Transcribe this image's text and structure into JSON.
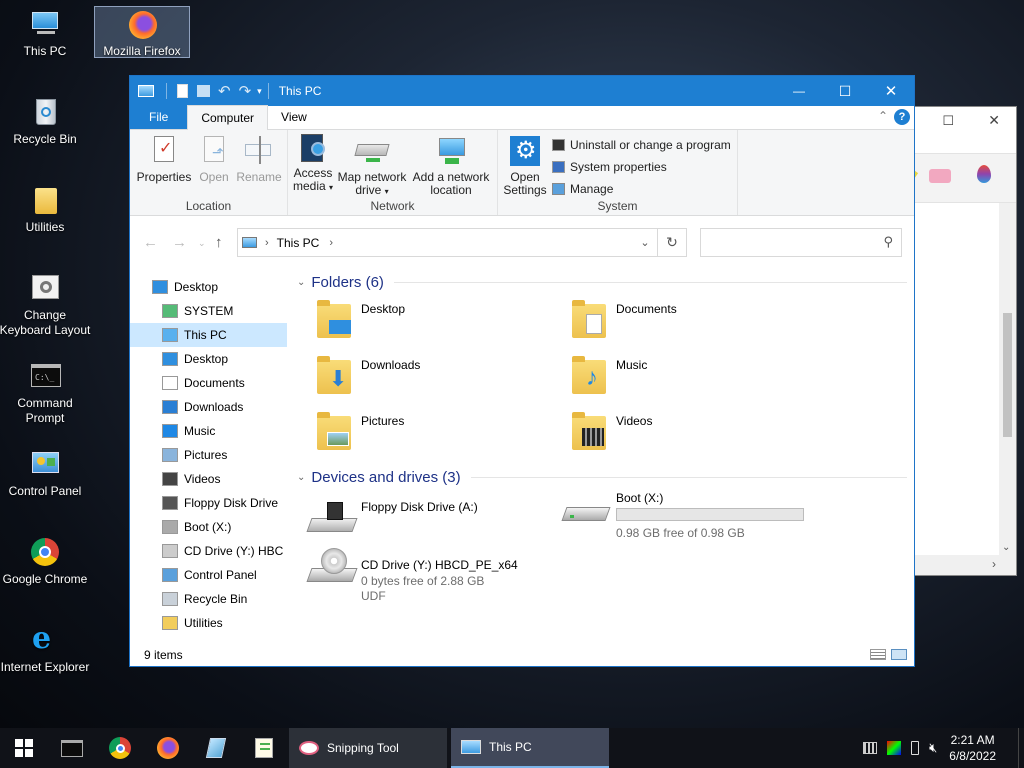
{
  "desktop": {
    "icons": [
      {
        "label": "This PC",
        "icon": "this-pc-icon"
      },
      {
        "label": "Mozilla Firefox",
        "icon": "firefox-icon"
      },
      {
        "label": "Recycle Bin",
        "icon": "recycle-bin-icon"
      },
      {
        "label": "Utilities",
        "icon": "folder-icon"
      },
      {
        "label": "Change Keyboard Layout",
        "icon": "keyboard-settings-icon"
      },
      {
        "label": "Command Prompt",
        "icon": "command-prompt-icon"
      },
      {
        "label": "Control Panel",
        "icon": "control-panel-icon"
      },
      {
        "label": "Google Chrome",
        "icon": "chrome-icon"
      },
      {
        "label": "Internet Explorer",
        "icon": "internet-explorer-icon"
      }
    ]
  },
  "window": {
    "title": "This PC",
    "title_buttons": {
      "minimize": "—",
      "maximize": "☐",
      "close": "✕"
    },
    "tabs": {
      "file": "File",
      "computer": "Computer",
      "view": "View"
    },
    "ribbon": {
      "location": {
        "label": "Location",
        "properties": "Properties",
        "open": "Open",
        "rename": "Rename"
      },
      "network": {
        "label": "Network",
        "access_media": "Access media",
        "map_network_drive": "Map network drive",
        "add_network_location": "Add a network location"
      },
      "system": {
        "label": "System",
        "open_settings": "Open Settings",
        "uninstall": "Uninstall or change a program",
        "system_properties": "System properties",
        "manage": "Manage"
      }
    },
    "address": {
      "path": "This PC",
      "search_placeholder": ""
    },
    "nav": [
      {
        "label": "Desktop",
        "level": 0,
        "icon": "desktop-icon"
      },
      {
        "label": "SYSTEM",
        "level": 1,
        "icon": "user-icon"
      },
      {
        "label": "This PC",
        "level": 1,
        "icon": "this-pc-icon",
        "selected": true
      },
      {
        "label": "Desktop",
        "level": 2,
        "icon": "desktop-icon"
      },
      {
        "label": "Documents",
        "level": 2,
        "icon": "documents-icon"
      },
      {
        "label": "Downloads",
        "level": 2,
        "icon": "downloads-icon"
      },
      {
        "label": "Music",
        "level": 2,
        "icon": "music-icon"
      },
      {
        "label": "Pictures",
        "level": 2,
        "icon": "pictures-icon"
      },
      {
        "label": "Videos",
        "level": 2,
        "icon": "videos-icon"
      },
      {
        "label": "Floppy Disk Drive",
        "level": 2,
        "icon": "floppy-icon"
      },
      {
        "label": "Boot (X:)",
        "level": 2,
        "icon": "drive-icon"
      },
      {
        "label": "CD Drive (Y:) HBC",
        "level": 2,
        "icon": "cd-drive-icon"
      },
      {
        "label": "Control Panel",
        "level": 1,
        "icon": "control-panel-icon"
      },
      {
        "label": "Recycle Bin",
        "level": 1,
        "icon": "recycle-bin-icon"
      },
      {
        "label": "Utilities",
        "level": 1,
        "icon": "folder-icon"
      }
    ],
    "folders_header": "Folders (6)",
    "folders": [
      {
        "name": "Desktop",
        "icon": "desktop-folder-icon"
      },
      {
        "name": "Documents",
        "icon": "documents-folder-icon"
      },
      {
        "name": "Downloads",
        "icon": "downloads-folder-icon"
      },
      {
        "name": "Music",
        "icon": "music-folder-icon"
      },
      {
        "name": "Pictures",
        "icon": "pictures-folder-icon"
      },
      {
        "name": "Videos",
        "icon": "videos-folder-icon"
      }
    ],
    "drives_header": "Devices and drives (3)",
    "drives": [
      {
        "name": "Floppy Disk Drive (A:)",
        "icon": "floppy-drive-icon",
        "free": "",
        "fs": ""
      },
      {
        "name": "Boot (X:)",
        "icon": "hard-drive-icon",
        "free": "0.98 GB free of 0.98 GB",
        "fs": "",
        "used_fraction": 0.0
      },
      {
        "name": "CD Drive (Y:) HBCD_PE_x64",
        "icon": "cd-drive-icon",
        "free": "0 bytes free of 2.88 GB",
        "fs": "UDF"
      }
    ],
    "status": "9 items"
  },
  "taskbar": {
    "snipping_tool": "Snipping Tool",
    "this_pc": "This PC",
    "time": "2:21 AM",
    "date": "6/8/2022"
  }
}
